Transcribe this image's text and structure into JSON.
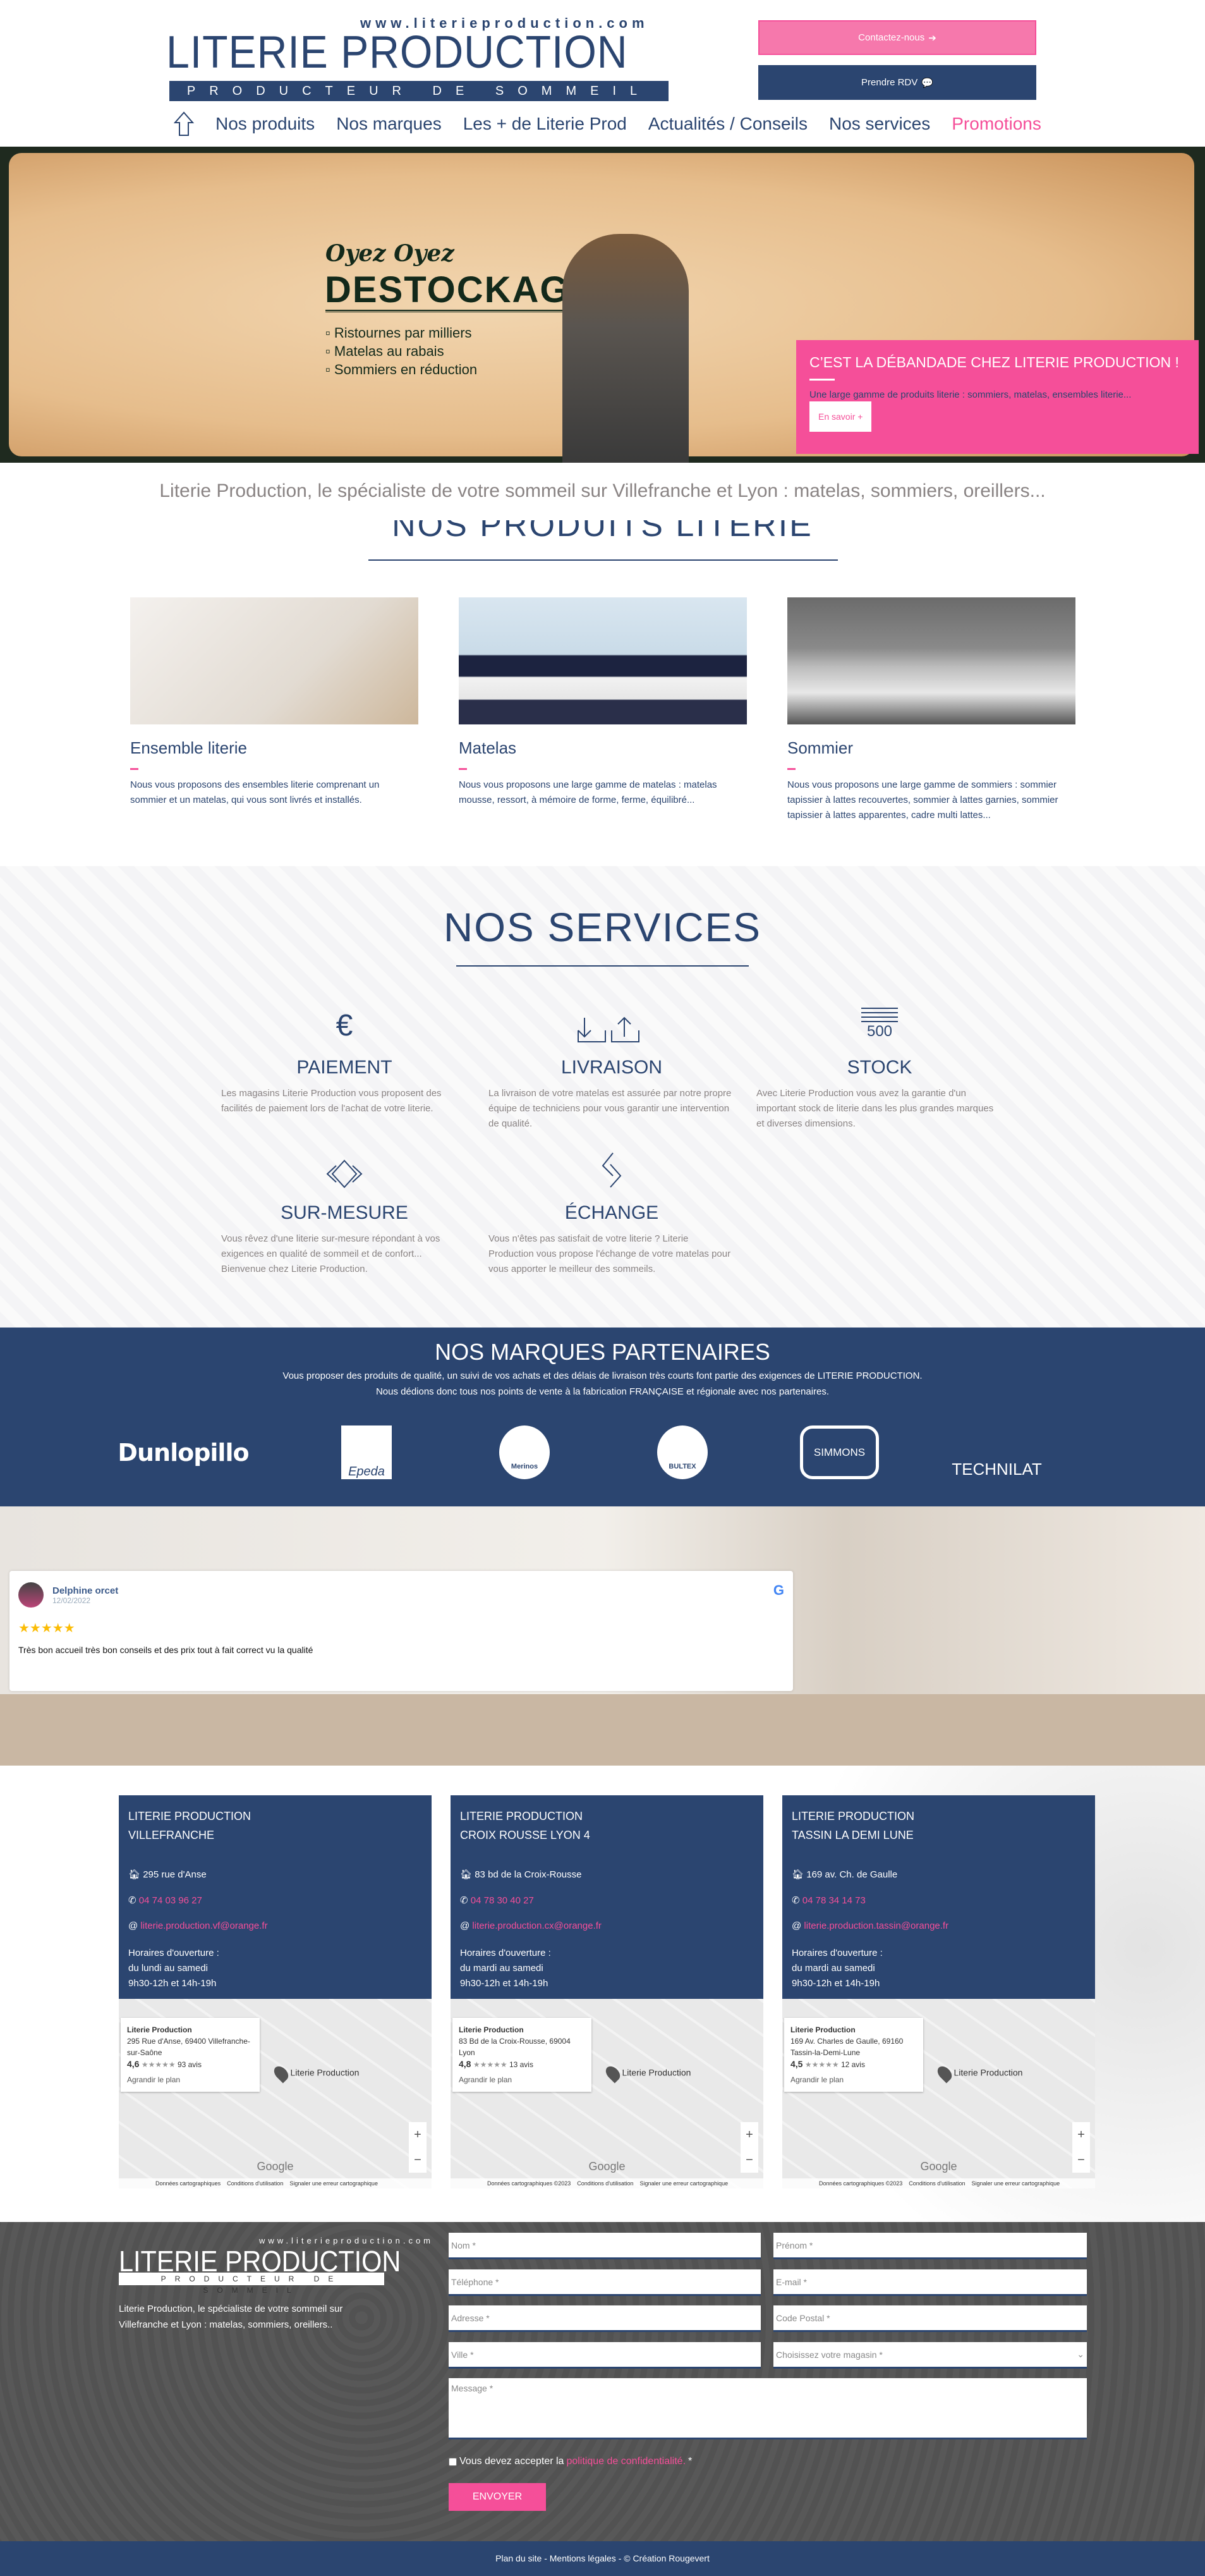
{
  "colors": {
    "navy": "#2b4570",
    "pink": "#f54f99",
    "grey_text": "#8a8484"
  },
  "header": {
    "logo_url": "www.literieproduction.com",
    "logo_main": "LITERIE PRODUCTION",
    "logo_sub": "PRODUCTEUR DE SOMMEIL",
    "contact_label": "Contactez-nous",
    "rdv_label": "Prendre RDV",
    "nav": [
      {
        "label": "Nos produits"
      },
      {
        "label": "Nos marques"
      },
      {
        "label": "Les + de Literie Prod"
      },
      {
        "label": "Actualités / Conseils"
      },
      {
        "label": "Nos services"
      },
      {
        "label": "Promotions"
      }
    ]
  },
  "hero": {
    "oyez": "Oyez Oyez",
    "title": "DESTOCKAGE",
    "bullets": [
      "Ristournes par milliers",
      "Matelas au rabais",
      "Sommiers en réduction"
    ],
    "promo_title": "C’EST LA DÉBANDADE CHEZ LITERIE PRODUCTION !",
    "promo_text": "Une large gamme de produits literie : sommiers, matelas, ensembles literie...",
    "promo_button": "En savoir +"
  },
  "intro": {
    "tagline": "Literie Production, le spécialiste de votre sommeil sur Villefranche et Lyon : matelas, sommiers, oreillers...",
    "products_heading": "NOS PRODUITS LITERIE"
  },
  "products": [
    {
      "title": "Ensemble literie",
      "text": "Nous vous proposons des ensembles literie comprenant un sommier et un matelas, qui vous sont livrés et installés."
    },
    {
      "title": "Matelas",
      "text": "Nous vous proposons une large gamme de matelas : matelas mousse, ressort, à mémoire de forme, ferme, équilibré..."
    },
    {
      "title": "Sommier",
      "text": "Nous vous proposons une large gamme de sommiers : sommier tapissier à lattes recouvertes, sommier à lattes garnies, sommier tapissier à lattes apparentes, cadre multi lattes..."
    }
  ],
  "services": {
    "heading": "NOS SERVICES",
    "items": [
      {
        "title": "PAIEMENT",
        "icon": "euro-icon",
        "text": "Les magasins Literie Production vous proposent des facilités de paiement lors de l'achat de votre literie."
      },
      {
        "title": "LIVRAISON",
        "icon": "delivery-icon",
        "text": "La livraison de votre matelas est assurée par notre propre équipe de techniciens pour vous garantir une intervention de qualité."
      },
      {
        "title": "STOCK",
        "icon": "stock-icon",
        "icon_text": "500",
        "text": "Avec Literie Production vous avez la garantie d'un important stock de literie dans les plus grandes marques et diverses dimensions."
      },
      {
        "title": "SUR-MESURE",
        "icon": "diamond-icon",
        "text": "Vous rêvez d'une literie sur-mesure répondant à vos exigences en qualité de sommeil et de confort... Bienvenue chez Literie Production."
      },
      {
        "title": "ÉCHANGE",
        "icon": "exchange-icon",
        "text": "Vous n'êtes pas satisfait de votre literie ? Literie Production vous propose l'échange de votre matelas pour vous apporter le meilleur des sommeils."
      }
    ]
  },
  "brands": {
    "heading": "NOS MARQUES PARTENAIRES",
    "text1": "Vous proposer des produits de qualité, un suivi de vos achats et des délais de livraison très courts font partie des exigences de LITERIE PRODUCTION.",
    "text2": "Nous dédions donc tous nos points de vente à la fabrication FRANÇAISE et régionale avec nos partenaires.",
    "logos": [
      "Dunlopillo",
      "Epeda",
      "Merinos",
      "Bultex",
      "Simmons",
      "Technilat"
    ]
  },
  "review": {
    "name": "Delphine orcet",
    "date": "12/02/2022",
    "stars": 5,
    "text": "Très bon accueil très bon conseils et des prix tout à fait correct vu la qualité"
  },
  "stores": [
    {
      "name1": "LITERIE PRODUCTION",
      "name2": "VILLEFRANCHE",
      "address": "295 rue d'Anse",
      "phone": "04 74 03 96 27",
      "email": "literie.production.vf@orange.fr",
      "hours_label": "Horaires d'ouverture :",
      "days": "du lundi au samedi",
      "hours": "9h30-12h et 14h-19h",
      "map": {
        "title": "Literie Production",
        "address": "295 Rue d'Anse, 69400 Villefranche-sur-Saône",
        "rating": "4,6",
        "stars": "★★★★★",
        "reviews": "93 avis",
        "link": "Agrandir le plan",
        "pin": "Literie Production",
        "footer": [
          "Données cartographiques",
          "Conditions d'utilisation",
          "Signaler une erreur cartographique"
        ]
      }
    },
    {
      "name1": "LITERIE PRODUCTION",
      "name2": "CROIX ROUSSE LYON 4",
      "address": "83 bd de la Croix-Rousse",
      "phone": "04 78 30 40 27",
      "email": "literie.production.cx@orange.fr",
      "hours_label": "Horaires d'ouverture :",
      "days": "du mardi au samedi",
      "hours": "9h30-12h et 14h-19h",
      "map": {
        "title": "Literie Production",
        "address": "83 Bd de la Croix-Rousse, 69004 Lyon",
        "rating": "4,8",
        "stars": "★★★★★",
        "reviews": "13 avis",
        "link": "Agrandir le plan",
        "pin": "Literie Production",
        "footer": [
          "Données cartographiques ©2023",
          "Conditions d'utilisation",
          "Signaler une erreur cartographique"
        ]
      }
    },
    {
      "name1": "LITERIE PRODUCTION",
      "name2": "TASSIN LA DEMI LUNE",
      "address": "169 av. Ch. de Gaulle",
      "phone": "04 78 34 14 73",
      "email": "literie.production.tassin@orange.fr",
      "hours_label": "Horaires d'ouverture :",
      "days": "du mardi au samedi",
      "hours": "9h30-12h et 14h-19h",
      "map": {
        "title": "Literie Production",
        "address": "169 Av. Charles de Gaulle, 69160 Tassin-la-Demi-Lune",
        "rating": "4,5",
        "stars": "★★★★★",
        "reviews": "12 avis",
        "link": "Agrandir le plan",
        "pin": "Literie Production",
        "footer": [
          "Données cartographiques ©2023",
          "Conditions d'utilisation",
          "Signaler une erreur cartographique"
        ]
      }
    }
  ],
  "footer": {
    "logo_url": "www.literieproduction.com",
    "logo_main": "LITERIE PRODUCTION",
    "logo_sub": "PRODUCTEUR DE SOMMEIL",
    "text": "Literie Production, le spécialiste de votre sommeil sur Villefranche et Lyon : matelas, sommiers, oreillers..",
    "form": {
      "nom": "Nom *",
      "prenom": "Prénom *",
      "telephone": "Téléphone *",
      "email": "E-mail *",
      "adresse": "Adresse *",
      "code_postal": "Code Postal *",
      "ville": "Ville *",
      "magasin": "Choisissez votre magasin *",
      "message": "Message *",
      "consent_prefix": "Vous devez accepter la",
      "consent_link": "politique de confidentialité.",
      "consent_suffix": "*",
      "submit": "ENVOYER"
    },
    "bottom": "Plan du site - Mentions légales - © Création Rougevert"
  }
}
